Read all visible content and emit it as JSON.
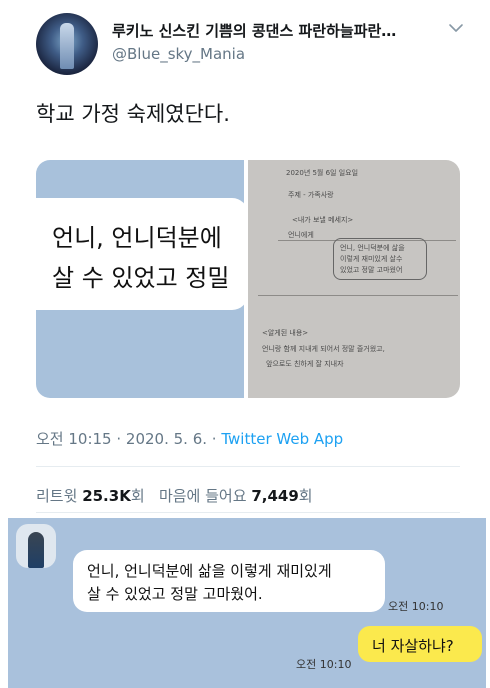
{
  "tweet": {
    "display_name": "루키노 신스킨 기쁨의 콩댄스 파란하늘파란…",
    "handle": "@Blue_sky_Mania",
    "text": "학교 가정 숙제였단다.",
    "more_icon": "chevron-down-icon"
  },
  "media": {
    "left_bubble": {
      "line1": "언니, 언니덕분에",
      "line2": "살 수 있었고 정밀"
    },
    "handwriting": {
      "date": "2020년 5월 6일 일요일",
      "theme": "주제 - 가족사랑",
      "title": "<내가 보낼 메세지>",
      "to": "언니에게",
      "box_line1": "언니, 언니덕분에 삶을",
      "box_line2": "이렇게 재미있게 살수",
      "box_line3": "있었고 정말 고마웠어",
      "note_label": "<알게된 내용>",
      "note_line1": "언니랑 함께 지내게 되어서 정말 즐거웠고,",
      "note_line2": "앞으로도 친하게 잘 지내자"
    }
  },
  "meta": {
    "time": "오전 10:15",
    "separator": " · ",
    "date": "2020. 5. 6.",
    "app": "Twitter Web App"
  },
  "stats": {
    "retweets_label": "리트윗",
    "retweets_count": "25.3K",
    "retweets_unit": "회",
    "likes_label": "마음에 들어요",
    "likes_count": "7,449",
    "likes_unit": "회"
  },
  "chat": {
    "incoming_line1": "언니, 언니덕분에 삶을 이렇게 재미있게",
    "incoming_line2": "살 수 있었고 정말 고마웠어.",
    "incoming_time": "오전 10:10",
    "outgoing_text": "너 자살하냐?",
    "outgoing_time": "오전 10:10"
  },
  "colors": {
    "link": "#1da1f2",
    "secondary_text": "#657786",
    "chat_background": "#a9c1dc",
    "outgoing_bubble": "#fbe94d"
  }
}
